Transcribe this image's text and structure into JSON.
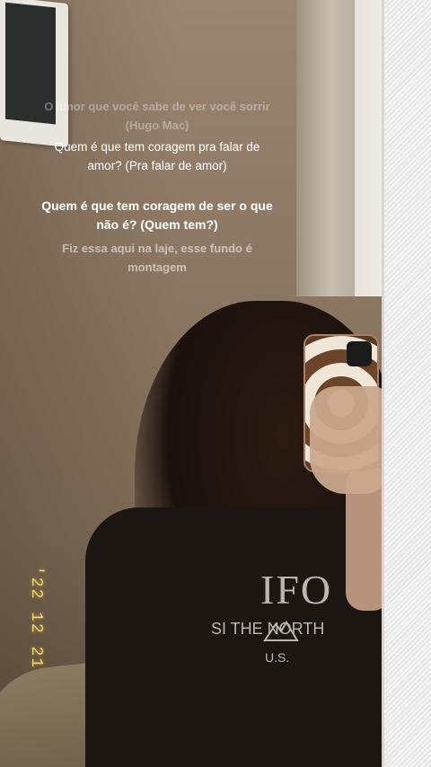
{
  "story": {
    "lyrics": [
      "O amor que você sabe de ver você sorrir (Hugo Mac)",
      "Quem é que tem coragem pra falar de amor? (Pra falar de amor)",
      "Quem é que tem coragem de ser o que não é? (Quem tem?)",
      "Fiz essa aqui na laje, esse fundo é montagem"
    ],
    "date_stamp": "'22 12 21"
  },
  "sweater": {
    "big_text": "IFO",
    "small_text": "SI      THE NORTH",
    "country": "U.S."
  },
  "colors": {
    "date_stamp": "#f1d46b",
    "lyric_text": "#ffffff"
  }
}
